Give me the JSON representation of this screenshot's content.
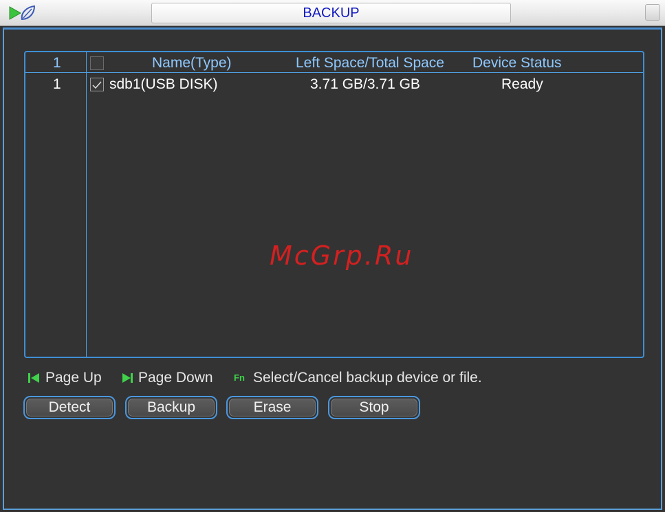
{
  "window": {
    "title": "BACKUP"
  },
  "table": {
    "headers": {
      "index": "1",
      "name": "Name(Type)",
      "space": "Left Space/Total Space",
      "status": "Device Status"
    },
    "rows": [
      {
        "index": "1",
        "checked": true,
        "name": "sdb1(USB DISK)",
        "space": "3.71 GB/3.71 GB",
        "status": "Ready"
      }
    ]
  },
  "watermark": "McGrp.Ru",
  "hints": {
    "page_up": "Page Up",
    "page_down": "Page Down",
    "fn_badge": "Fn",
    "fn_text": "Select/Cancel backup device or file."
  },
  "buttons": {
    "detect": "Detect",
    "backup": "Backup",
    "erase": "Erase",
    "stop": "Stop"
  },
  "colors": {
    "title_text": "#1018c0",
    "header_text": "#8ec8ff",
    "accent_border": "#3f8fd6",
    "hint_icon_green": "#3fd24a",
    "watermark_red": "#d42020"
  },
  "icons": {
    "title_logo": "play-leaf-icon",
    "close": "close-icon",
    "page_up": "skip-back-icon",
    "page_down": "skip-forward-icon",
    "checkbox": "checkmark-icon"
  }
}
